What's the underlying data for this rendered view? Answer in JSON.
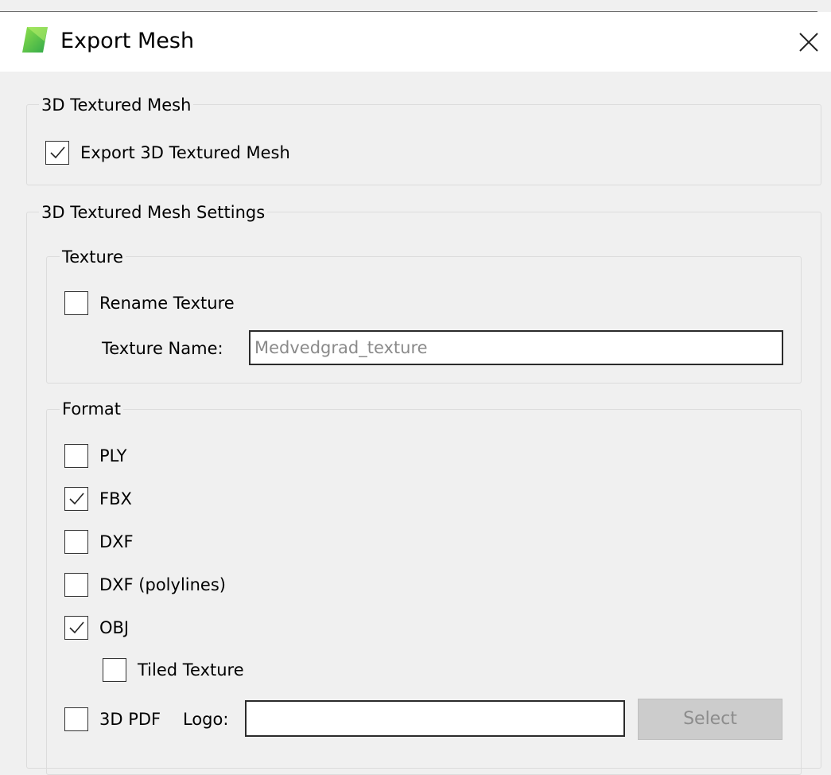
{
  "window": {
    "title": "Export Mesh",
    "icon": "app-logo-icon",
    "close_icon": "close-icon",
    "accent_color": "#5ecb3c"
  },
  "mesh_group": {
    "title": "3D Textured Mesh",
    "export_checkbox": {
      "label": "Export 3D Textured Mesh",
      "checked": true
    }
  },
  "settings_group": {
    "title": "3D Textured Mesh Settings",
    "texture": {
      "title": "Texture",
      "rename_checkbox": {
        "label": "Rename Texture",
        "checked": false
      },
      "name_label": "Texture Name:",
      "name_placeholder": "Medvedgrad_texture"
    },
    "format": {
      "title": "Format",
      "options": [
        {
          "label": "PLY",
          "checked": false
        },
        {
          "label": "FBX",
          "checked": true
        },
        {
          "label": "DXF",
          "checked": false
        },
        {
          "label": "DXF (polylines)",
          "checked": false
        },
        {
          "label": "OBJ",
          "checked": true
        }
      ],
      "tiled_texture": {
        "label": "Tiled Texture",
        "checked": false
      },
      "pdf": {
        "label": "3D PDF",
        "checked": false
      },
      "logo_label": "Logo:",
      "logo_value": "",
      "select_label": "Select"
    }
  }
}
